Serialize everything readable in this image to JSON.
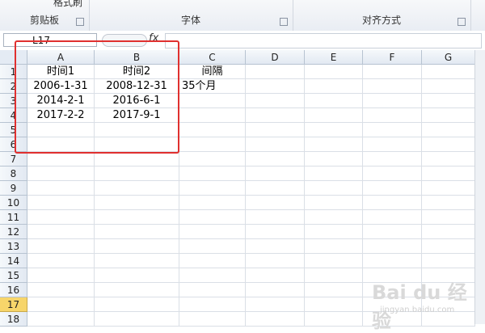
{
  "ribbon": {
    "top_partial": "格式刷",
    "groups": [
      {
        "label": "剪贴板"
      },
      {
        "label": "字体"
      },
      {
        "label": "对齐方式"
      }
    ]
  },
  "formula_bar": {
    "name_box": "L17",
    "fx": "fx",
    "content": ""
  },
  "columns": [
    "A",
    "B",
    "C",
    "D",
    "E",
    "F",
    "G"
  ],
  "rows": [
    "1",
    "2",
    "3",
    "4",
    "5",
    "6",
    "7",
    "8",
    "9",
    "10",
    "11",
    "12",
    "13",
    "14",
    "15",
    "16",
    "17",
    "18"
  ],
  "active_row": "17",
  "cells": {
    "A1": "时间1",
    "B1": "时间2",
    "C1": "间隔",
    "A2": "2006-1-31",
    "B2": "2008-12-31",
    "C2": "35个月",
    "A3": "2014-2-1",
    "B3": "2016-6-1",
    "A4": "2017-2-2",
    "B4": "2017-9-1"
  },
  "watermark": {
    "main": "Bai du 经验",
    "sub": "jingyan.baidu.com"
  }
}
